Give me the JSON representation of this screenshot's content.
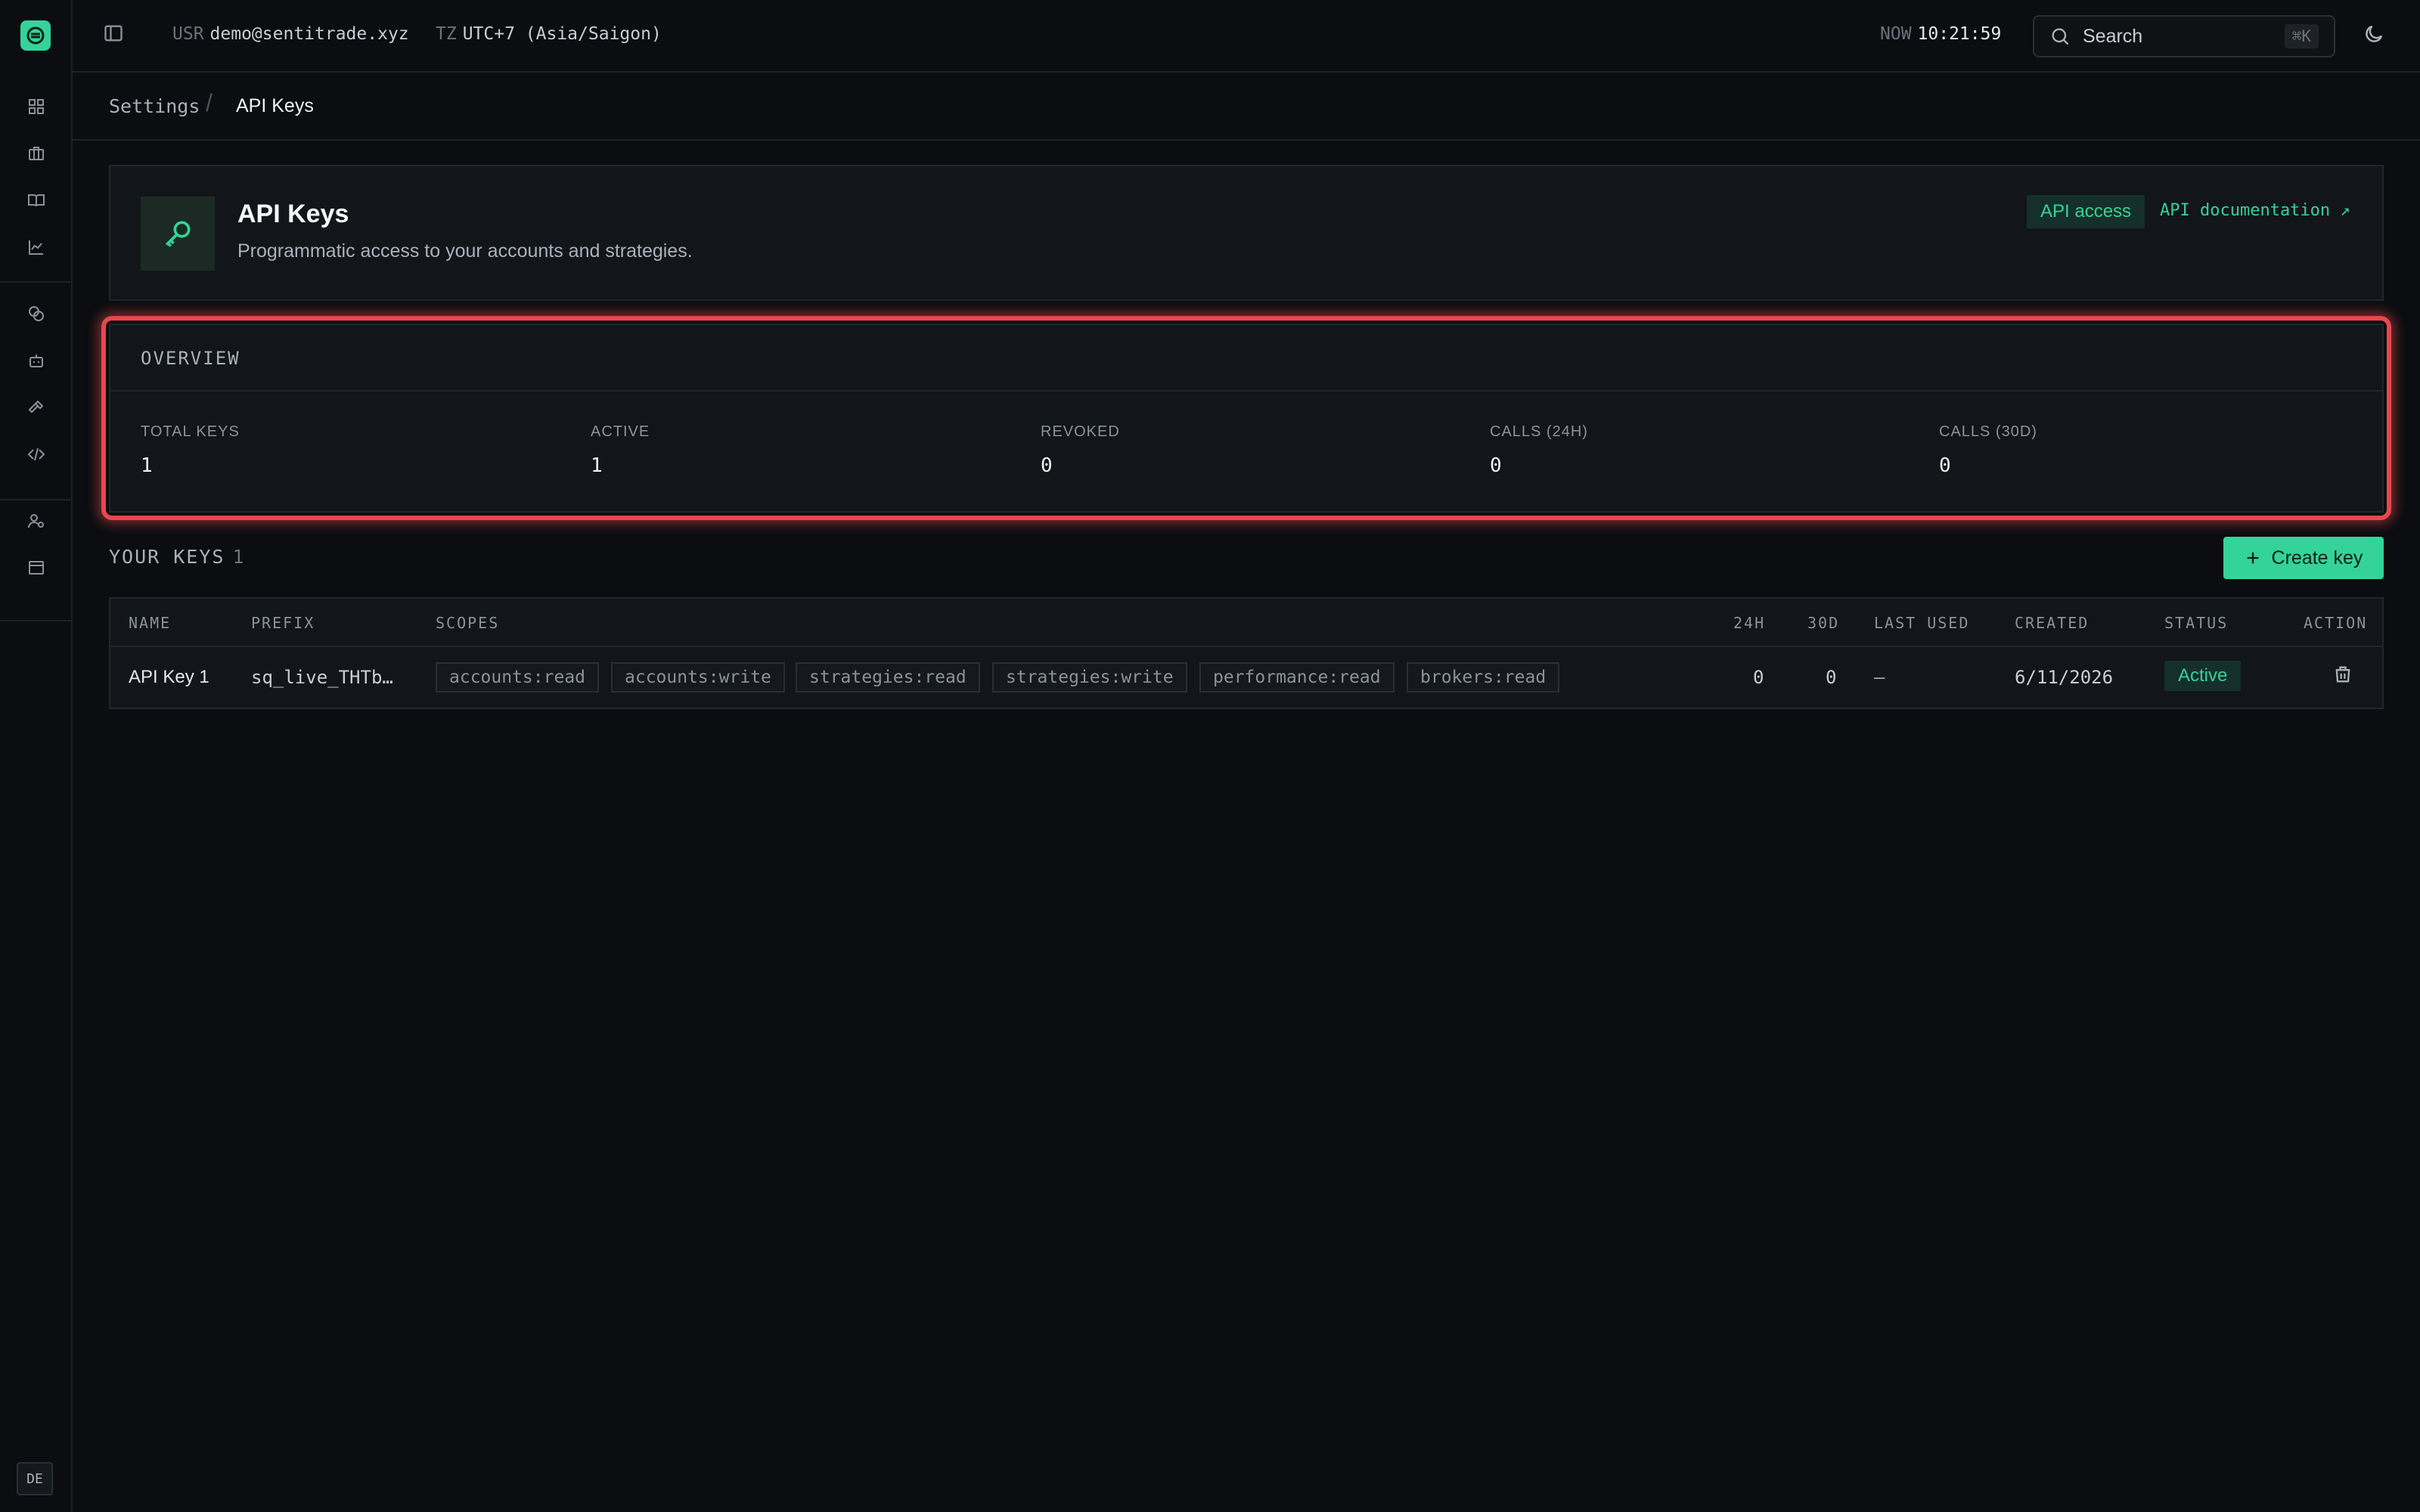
{
  "sidebar": {
    "icons": [
      "dashboard-icon",
      "briefcase-icon",
      "book-icon",
      "chart-icon",
      "coins-icon",
      "bot-icon",
      "hammer-icon",
      "code-icon",
      "user-settings-icon",
      "archive-icon"
    ],
    "language": "DE"
  },
  "topbar": {
    "user_key": "USR",
    "user": "demo@sentitrade.xyz",
    "tz_key": "TZ",
    "timezone": "UTC+7 (Asia/Saigon)",
    "now_key": "NOW",
    "now": "10:21:59",
    "search_placeholder": "Search",
    "search_shortcut": "⌘K"
  },
  "breadcrumb": {
    "parent": "Settings",
    "separator": "/",
    "current": "API Keys"
  },
  "header": {
    "title": "API Keys",
    "subtitle": "Programmatic access to your accounts and strategies.",
    "badge": "API access",
    "doc_link": "API documentation ↗"
  },
  "overview": {
    "title": "OVERVIEW",
    "stats": [
      {
        "label": "TOTAL KEYS",
        "value": "1"
      },
      {
        "label": "ACTIVE",
        "value": "1"
      },
      {
        "label": "REVOKED",
        "value": "0"
      },
      {
        "label": "CALLS (24H)",
        "value": "0"
      },
      {
        "label": "CALLS (30D)",
        "value": "0"
      }
    ]
  },
  "keys": {
    "title": "YOUR KEYS",
    "count": "1",
    "create_label": "Create key",
    "columns": [
      "NAME",
      "PREFIX",
      "SCOPES",
      "24H",
      "30D",
      "LAST USED",
      "CREATED",
      "STATUS",
      "ACTION"
    ],
    "rows": [
      {
        "name": "API Key 1",
        "prefix": "sq_live_THTb…",
        "scopes": [
          "accounts:read",
          "accounts:write",
          "strategies:read",
          "strategies:write",
          "performance:read",
          "brokers:read"
        ],
        "calls_24h": "0",
        "calls_30d": "0",
        "last_used": "—",
        "created": "6/11/2026",
        "status": "Active"
      }
    ]
  },
  "colors": {
    "accent": "#34d399",
    "highlight": "#e5484d",
    "background": "#0b0d10"
  }
}
